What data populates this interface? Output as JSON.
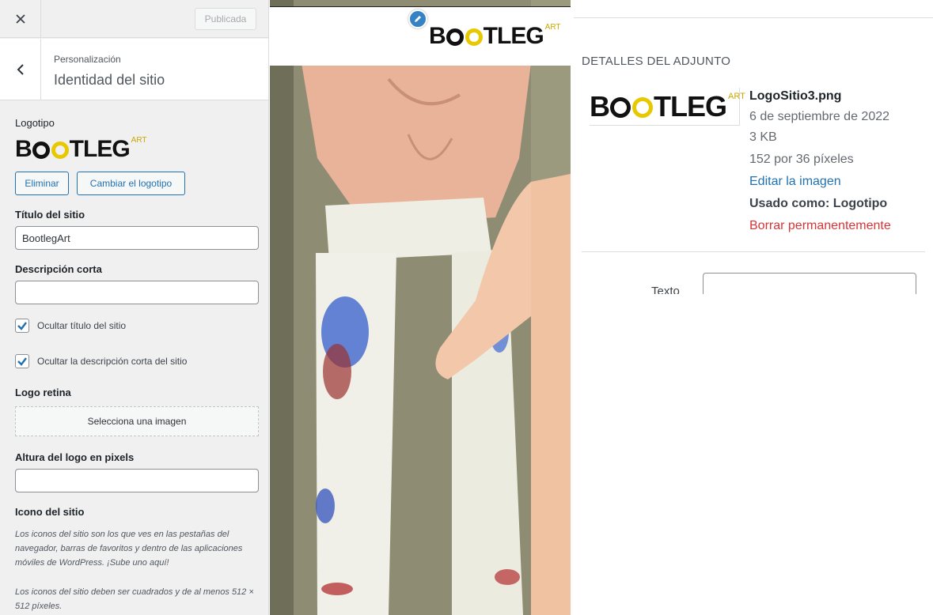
{
  "customizer": {
    "close_icon": "close-icon",
    "publish_label": "Publicada",
    "back_icon": "chevron-left-icon",
    "breadcrumb": "Personalización",
    "section_title": "Identidad del sitio",
    "logo": {
      "label": "Logotipo",
      "logo_text_prefix": "B",
      "logo_text_o1": "O",
      "logo_text_o2": "O",
      "logo_text_suffix": "TLEG",
      "logo_superscript": "ART",
      "remove_label": "Eliminar",
      "change_label": "Cambiar el logotipo"
    },
    "site_title": {
      "label": "Título del sitio",
      "value": "BootlegArt"
    },
    "tagline": {
      "label": "Descripción corta",
      "value": ""
    },
    "hide_title": {
      "label": "Ocultar título del sitio",
      "checked": true
    },
    "hide_tagline": {
      "label": "Ocultar la descripción corta del sitio",
      "checked": true
    },
    "retina_logo": {
      "label": "Logo retina",
      "select_label": "Selecciona una imagen"
    },
    "logo_height": {
      "label": "Altura del logo en pixels",
      "value": ""
    },
    "site_icon": {
      "label": "Icono del sitio",
      "description": "Los iconos del sitio son los que ves en las pestañas del navegador, barras de favoritos y dentro de las aplicaciones móviles de WordPress. ¡Sube uno aquí!",
      "requirement": "Los iconos del sitio deben ser cuadrados y de al menos 512 × 512 píxeles."
    }
  },
  "preview": {
    "edit_icon": "pencil-icon",
    "photo_description_icon": "preview-photo"
  },
  "attachment": {
    "heading": "DETALLES DEL ADJUNTO",
    "filename": "LogoSitio3.png",
    "date": "6 de septiembre de 2022",
    "size": "3 KB",
    "dimensions": "152 por 36 píxeles",
    "edit_link": "Editar la imagen",
    "used_as": "Usado como: Logotipo",
    "delete_link": "Borrar permanentemente",
    "text_label": "Texto",
    "text_value": ""
  },
  "colors": {
    "accent": "#2271b1",
    "danger": "#d63638",
    "logo_yellow": "#e8c800"
  }
}
